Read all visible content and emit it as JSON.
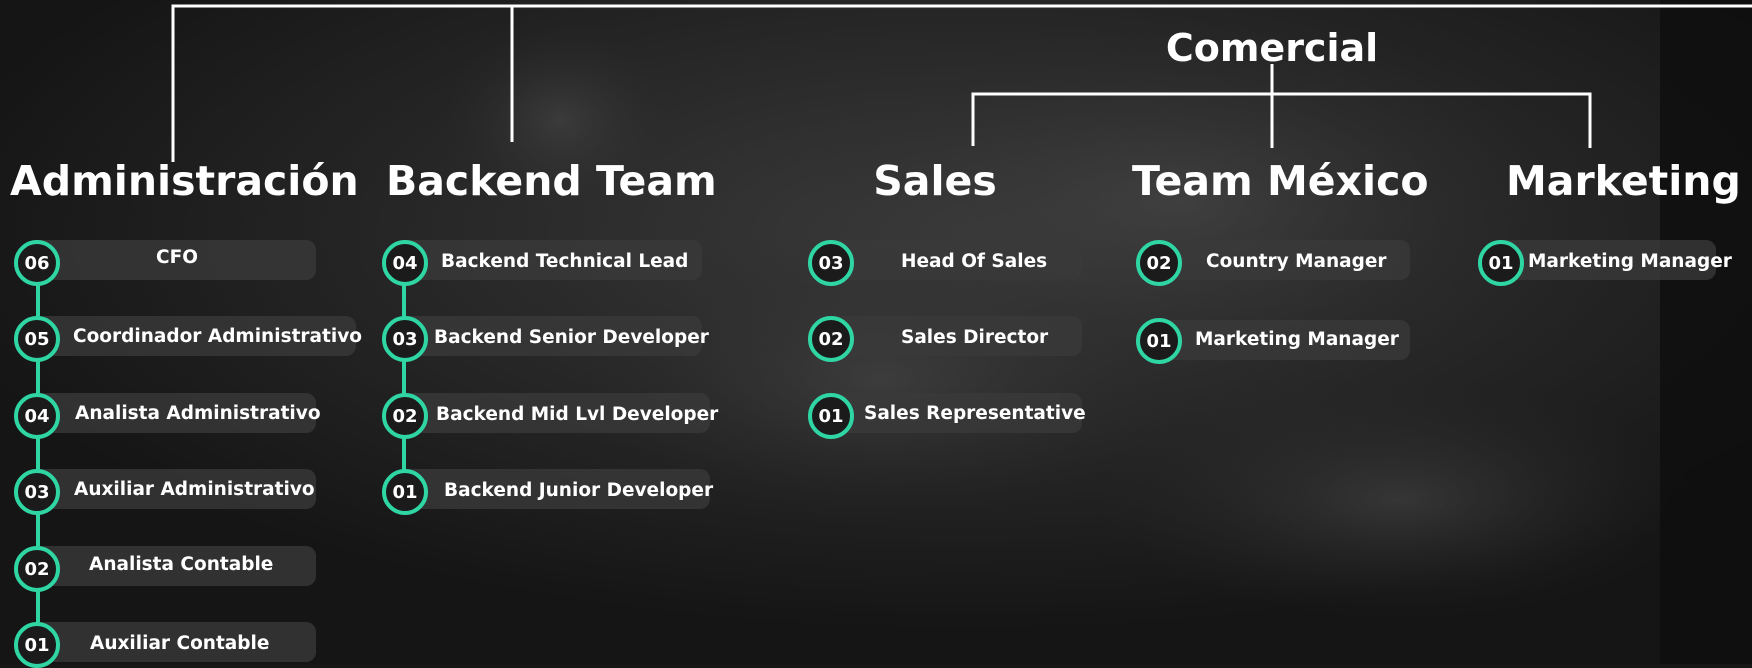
{
  "colors": {
    "accent": "#2fd6a4",
    "background": "#171717",
    "text": "#ffffff",
    "pill": "#3a3a3a"
  },
  "group": {
    "title": "Comercial"
  },
  "departments": {
    "administracion": {
      "title": "Administración",
      "roles": [
        {
          "level": "06",
          "label": "CFO"
        },
        {
          "level": "05",
          "label": "Coordinador Administrativo"
        },
        {
          "level": "04",
          "label": "Analista Administrativo"
        },
        {
          "level": "03",
          "label": "Auxiliar Administrativo"
        },
        {
          "level": "02",
          "label": "Analista Contable"
        },
        {
          "level": "01",
          "label": "Auxiliar Contable"
        }
      ]
    },
    "backend": {
      "title": "Backend Team",
      "roles": [
        {
          "level": "04",
          "label": "Backend Technical Lead"
        },
        {
          "level": "03",
          "label": "Backend Senior Developer"
        },
        {
          "level": "02",
          "label": "Backend Mid Lvl Developer"
        },
        {
          "level": "01",
          "label": "Backend Junior Developer"
        }
      ]
    },
    "sales": {
      "title": "Sales",
      "roles": [
        {
          "level": "03",
          "label": "Head Of Sales"
        },
        {
          "level": "02",
          "label": "Sales Director"
        },
        {
          "level": "01",
          "label": "Sales Representative"
        }
      ]
    },
    "mexico": {
      "title": "Team México",
      "roles": [
        {
          "level": "02",
          "label": "Country Manager"
        },
        {
          "level": "01",
          "label": "Marketing Manager"
        }
      ]
    },
    "marketing": {
      "title": "Marketing",
      "roles": [
        {
          "level": "01",
          "label": "Marketing Manager"
        }
      ]
    }
  }
}
